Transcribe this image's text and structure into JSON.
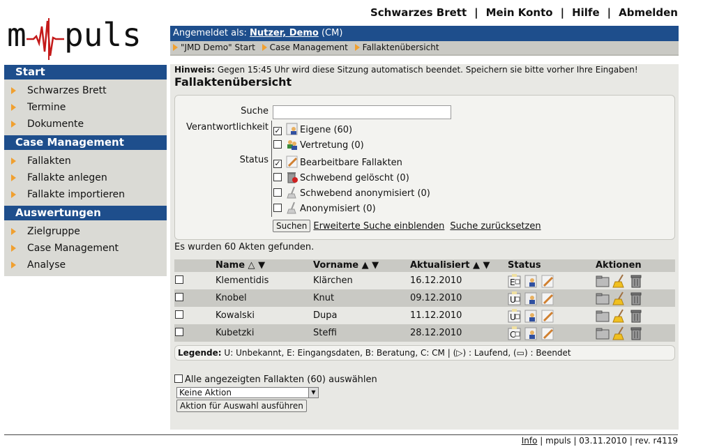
{
  "logo": {
    "text": "m puls"
  },
  "topnav": {
    "items": [
      "Schwarzes Brett",
      "Mein Konto",
      "Hilfe",
      "Abmelden"
    ]
  },
  "loginbar": {
    "prefix": "Angemeldet als:",
    "user": "Nutzer, Demo",
    "role": "(CM)"
  },
  "breadcrumb": [
    "\"JMD Demo\" Start",
    "Case Management",
    "Fallaktenübersicht"
  ],
  "sidebar": {
    "sections": [
      {
        "title": "Start",
        "items": [
          "Schwarzes Brett",
          "Termine",
          "Dokumente"
        ]
      },
      {
        "title": "Case Management",
        "items": [
          "Fallakten",
          "Fallakte anlegen",
          "Fallakte importieren"
        ]
      },
      {
        "title": "Auswertungen",
        "items": [
          "Zielgruppe",
          "Case Management",
          "Analyse"
        ]
      }
    ]
  },
  "main": {
    "hint_label": "Hinweis:",
    "hint_text": "Gegen 15:45 Uhr wird diese Sitzung automatisch beendet. Speichern sie bitte vorher Ihre Eingaben!",
    "title": "Fallaktenübersicht",
    "search": {
      "label_search": "Suche",
      "search_value": "",
      "label_responsibility": "Verantwortlichkeit",
      "label_status": "Status",
      "options": [
        {
          "label": "Eigene (60)",
          "checked": true
        },
        {
          "label": "Vertretung (0)",
          "checked": false
        },
        {
          "label": "Bearbeitbare Fallakten",
          "checked": true
        },
        {
          "label": "Schwebend gelöscht (0)",
          "checked": false
        },
        {
          "label": "Schwebend anonymisiert (0)",
          "checked": false
        },
        {
          "label": "Anonymisiert (0)",
          "checked": false
        }
      ],
      "search_button": "Suchen",
      "advanced_link": "Erweiterte Suche einblenden",
      "reset_link": "Suche zurücksetzen"
    },
    "found_text": "Es wurden 60 Akten gefunden.",
    "table": {
      "headers": {
        "name": "Name △ ▼",
        "vorname": "Vorname ▲ ▼",
        "aktualisiert": "Aktualisiert ▲ ▼",
        "status": "Status",
        "aktionen": "Aktionen"
      },
      "rows": [
        {
          "name": "Klementidis",
          "vorname": "Klärchen",
          "date": "16.12.2010",
          "phase": "E"
        },
        {
          "name": "Knobel",
          "vorname": "Knut",
          "date": "09.12.2010",
          "phase": "U"
        },
        {
          "name": "Kowalski",
          "vorname": "Dupa",
          "date": "11.12.2010",
          "phase": "U"
        },
        {
          "name": "Kubetzki",
          "vorname": "Steffi",
          "date": "28.12.2010",
          "phase": "C"
        }
      ]
    },
    "legend": {
      "label": "Legende:",
      "text": "U: Unbekannt, E: Eingangsdaten, B: Beratung, C: CM | (▷) : Laufend, (▭) : Beendet"
    },
    "select_all": "Alle angezeigten Fallakten (60) auswählen",
    "action_select": "Keine Aktion",
    "action_button": "Aktion für Auswahl ausführen"
  },
  "footer": {
    "info": "Info",
    "rest": " | mpuls | 03.11.2010 | rev. r4119"
  },
  "colors": {
    "header_blue": "#1e4e8c",
    "nav_gray": "#dadad5",
    "accent_orange": "#f0a030"
  }
}
